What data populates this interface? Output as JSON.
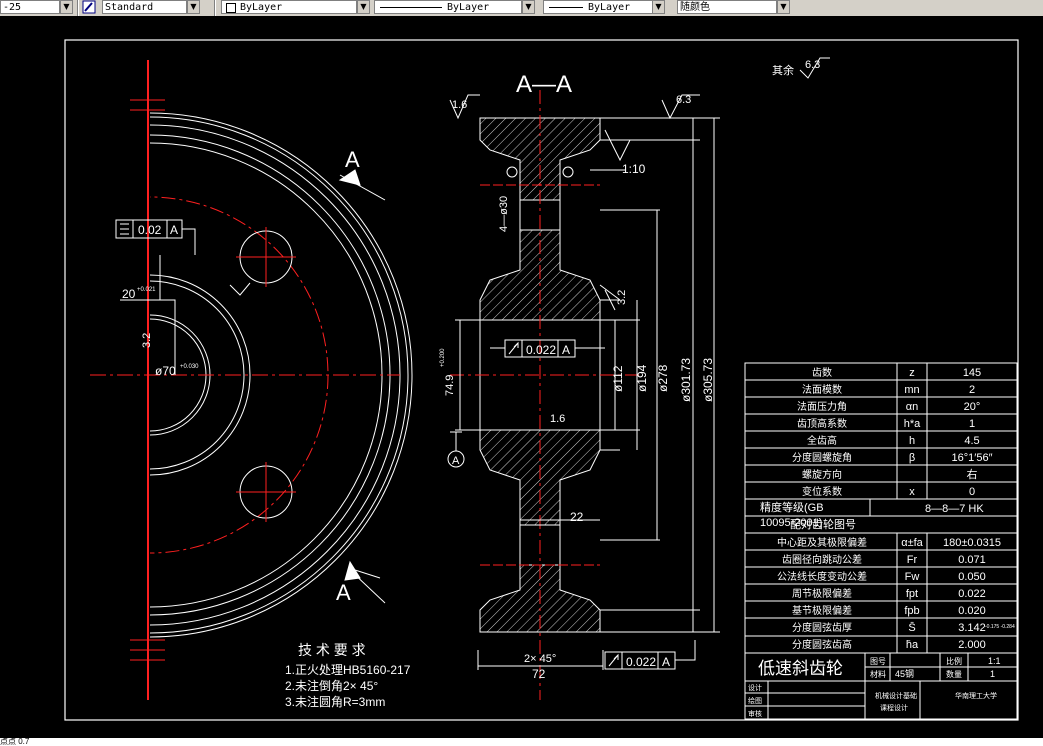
{
  "toolbar": {
    "scale_value": "-25",
    "text_style": "Standard",
    "layer": "ByLayer",
    "linetype": "ByLayer",
    "lineweight": "ByLayer",
    "plot_style": "随颜色"
  },
  "drawing": {
    "section_title": "A—A",
    "rest_surface_label": "其余",
    "rest_roughness": "6.3",
    "roughness_1_6": "1.6",
    "roughness_6_3": "6.3",
    "roughness_3_2": "3.2",
    "roughness_1_6_b": "1.6",
    "view_label_a": "A",
    "datum_label": "A",
    "taper_label": "1:10",
    "keyway_dim": "4—ø30",
    "flatness_value": "0.02",
    "flatness_datum": "A",
    "runout_value_1": "0.022",
    "runout_datum_1": "A",
    "runout_value_2": "0.022",
    "runout_datum_2": "A",
    "hub_dim": "20",
    "hub_tol": "+0.021",
    "key_dim": "3.2",
    "bore_dim": "ø70",
    "bore_tol": "+0.030",
    "hub_width": "74.9",
    "hub_width_tol": "+0.200",
    "d112": "ø112",
    "d194": "ø194",
    "d278": "ø278",
    "d301": "ø301.73",
    "d305": "ø305.73",
    "web_dim": "22",
    "chamfer_dim": "2× 45°",
    "face_width": "72"
  },
  "notes": {
    "title": "技 术 要 求",
    "items": [
      "1.正火处理HB5160-217",
      "2.未注倒角2× 45°",
      "3.未注圆角R=3mm"
    ]
  },
  "param_table": {
    "rows": [
      {
        "name": "齿数",
        "sym": "z",
        "val": "145"
      },
      {
        "name": "法面模数",
        "sym": "mn",
        "val": "2"
      },
      {
        "name": "法面压力角",
        "sym": "αn",
        "val": "20°"
      },
      {
        "name": "齿顶高系数",
        "sym": "h*a",
        "val": "1"
      },
      {
        "name": "全齿高",
        "sym": "h",
        "val": "4.5"
      },
      {
        "name": "分度圆螺旋角",
        "sym": "β",
        "val": "16°1′56″"
      },
      {
        "name": "螺旋方向",
        "sym": "",
        "val": "右"
      },
      {
        "name": "变位系数",
        "sym": "x",
        "val": "0"
      }
    ],
    "precision_label": "精度等级(GB",
    "precision_std": "10095-2001)",
    "precision_val": "8—8—7 HK",
    "mating_gear": "配对齿轮图号",
    "rows2": [
      {
        "name": "中心距及其极限偏差",
        "sym": "α±fa",
        "val": "180±0.0315"
      },
      {
        "name": "齿圈径向跳动公差",
        "sym": "Fr",
        "val": "0.071"
      },
      {
        "name": "公法线长度变动公差",
        "sym": "Fw",
        "val": "0.050"
      },
      {
        "name": "周节极限偏差",
        "sym": "fpt",
        "val": "0.022"
      },
      {
        "name": "基节极限偏差",
        "sym": "fpb",
        "val": "0.020"
      },
      {
        "name": "分度圆弦齿厚",
        "sym": "S̄",
        "val": "3.142"
      },
      {
        "name": "分度圆弦齿高",
        "sym": "h̄a",
        "val": "2.000"
      }
    ],
    "s_tol": "-0.175 -0.284"
  },
  "title_block": {
    "part_name": "低速斜齿轮",
    "drawing_no_label": "图号",
    "scale_label": "比例",
    "scale_value": "1:1",
    "material_label": "材料",
    "material_value": "45钢",
    "qty_label": "数量",
    "qty_value": "1",
    "design_label": "设计",
    "draw_label": "绘图",
    "review_label": "审核",
    "course": "机械设计基础",
    "course2": "课程设计",
    "school": "华南理工大学"
  },
  "status": {
    "text": "点点 0.7"
  }
}
